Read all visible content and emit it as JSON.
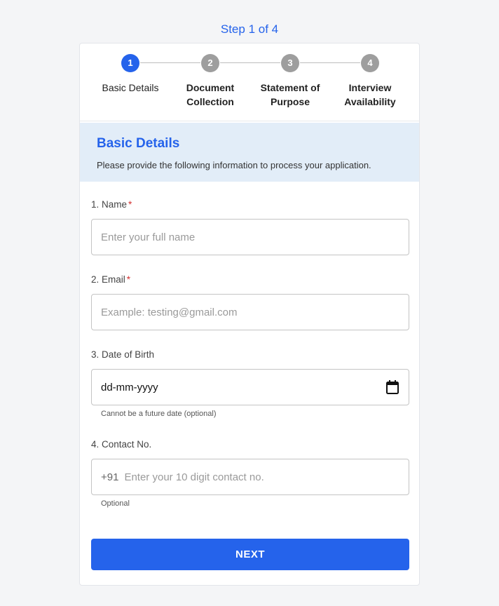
{
  "header": {
    "step_indicator": "Step 1 of 4"
  },
  "stepper": {
    "steps": [
      {
        "number": "1",
        "label_line1": "Basic Details",
        "label_line2": ""
      },
      {
        "number": "2",
        "label_line1": "Document",
        "label_line2": "Collection"
      },
      {
        "number": "3",
        "label_line1": "Statement of",
        "label_line2": "Purpose"
      },
      {
        "number": "4",
        "label_line1": "Interview",
        "label_line2": "Availability"
      }
    ],
    "active_color": "#2563eb",
    "inactive_color": "#9e9e9e"
  },
  "section": {
    "title": "Basic Details",
    "subtitle": "Please provide the following information to process your application."
  },
  "fields": {
    "name": {
      "label": "1. Name",
      "required": "*",
      "placeholder": "Enter your full name",
      "value": ""
    },
    "email": {
      "label": "2. Email",
      "required": "*",
      "placeholder": "Example: testing@gmail.com",
      "value": ""
    },
    "dob": {
      "label": "3. Date of Birth",
      "value": "dd-mm-yyyy",
      "helper": "Cannot be a future date (optional)",
      "icon": "calendar-icon"
    },
    "contact": {
      "label": "4. Contact No.",
      "prefix": "+91",
      "placeholder": "Enter your 10 digit contact no.",
      "value": "",
      "helper": "Optional"
    }
  },
  "actions": {
    "next_label": "NEXT",
    "button_color": "#2563eb"
  }
}
